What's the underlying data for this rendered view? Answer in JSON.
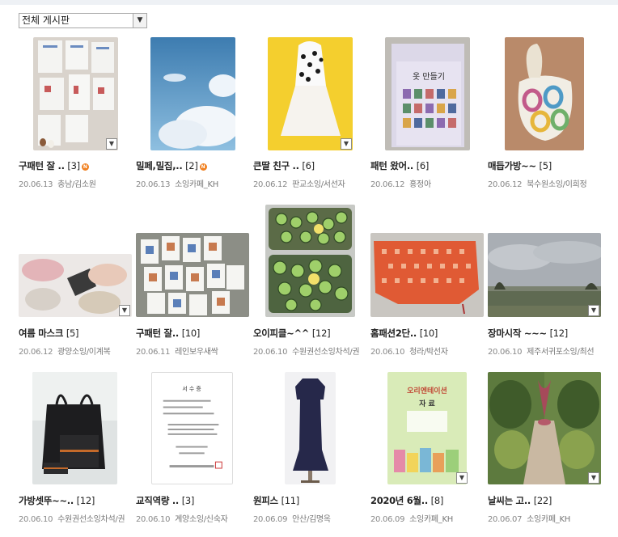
{
  "board_select": {
    "value": "전체 게시판",
    "arrow_icon": "chevron-down-icon"
  },
  "posts": [
    {
      "title": "구패턴 잘 ..",
      "count": "[3]",
      "new": true,
      "date": "20.06.13",
      "author": "충남/김소원"
    },
    {
      "title": "밀페,밀집,..",
      "count": "[2]",
      "new": true,
      "date": "20.06.13",
      "author": "소잉카페_KH"
    },
    {
      "title": "큰딸 친구 ..",
      "count": "[6]",
      "new": false,
      "date": "20.06.12",
      "author": "판교소잉/서선자"
    },
    {
      "title": "패턴 왔어..",
      "count": "[6]",
      "new": false,
      "date": "20.06.12",
      "author": "홍정아"
    },
    {
      "title": "매듭가방~~",
      "count": "[5]",
      "new": false,
      "date": "20.06.12",
      "author": "북수원소잉/이희정"
    },
    {
      "title": "여름 마스크",
      "count": "[5]",
      "new": false,
      "date": "20.06.12",
      "author": "광양소잉/이계복"
    },
    {
      "title": "구패턴 잘..",
      "count": "[10]",
      "new": false,
      "date": "20.06.11",
      "author": "레인보우새싹"
    },
    {
      "title": "오이피클~^^",
      "count": "[12]",
      "new": false,
      "date": "20.06.10",
      "author": "수원권선소잉차석/권"
    },
    {
      "title": "홈패션2단..",
      "count": "[10]",
      "new": false,
      "date": "20.06.10",
      "author": "청라/박선자"
    },
    {
      "title": "장마시작 ~~~",
      "count": "[12]",
      "new": false,
      "date": "20.06.10",
      "author": "제주서귀포소잉/최선"
    },
    {
      "title": "가방셋뚜~~..",
      "count": "[12]",
      "new": false,
      "date": "20.06.10",
      "author": "수원권선소잉차석/권"
    },
    {
      "title": "교직역량 ..",
      "count": "[3]",
      "new": false,
      "date": "20.06.10",
      "author": "계양소잉/신숙자"
    },
    {
      "title": "원피스",
      "count": "[11]",
      "new": false,
      "date": "20.06.09",
      "author": "안산/김명옥"
    },
    {
      "title": "2020년 6월..",
      "count": "[8]",
      "new": false,
      "date": "20.06.09",
      "author": "소잉카페_KH"
    },
    {
      "title": "날씨는 고..",
      "count": "[22]",
      "new": false,
      "date": "20.06.07",
      "author": "소잉카페_KH"
    }
  ],
  "new_badge_text": "N",
  "thumb_texts": {
    "book_title": "옷 만들기",
    "doc_title": "서 수 증",
    "poster_title": "오리엔테이션",
    "poster_sub": "자 료"
  },
  "colors": {
    "accent": "#f08020",
    "title": "#222222",
    "meta": "#777777"
  }
}
